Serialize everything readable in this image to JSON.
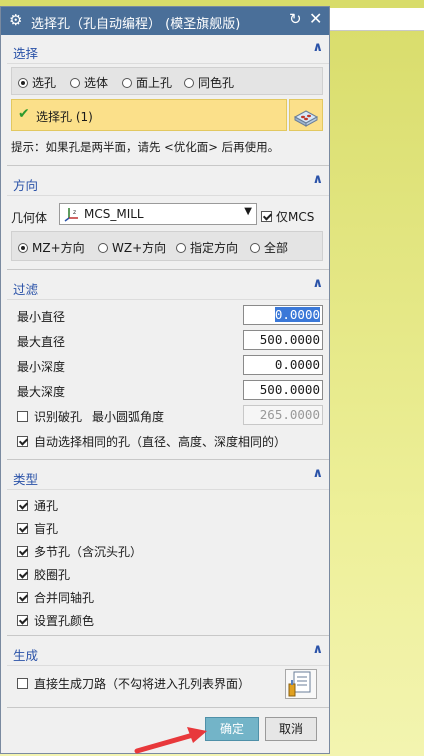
{
  "dialog": {
    "title": "选择孔（孔自动编程）   (模圣旗舰版)"
  },
  "select": {
    "header": "选择",
    "radios": [
      "选孔",
      "选体",
      "面上孔",
      "同色孔"
    ],
    "selected_radio": 0,
    "selected_label": "选择孔 (1)",
    "hint": "提示：如果孔是两半面，请先 <优化面> 后再使用。"
  },
  "direction": {
    "header": "方向",
    "geometry_label": "几何体",
    "geometry_value": "MCS_MILL",
    "only_mcs_label": "仅MCS",
    "only_mcs_checked": true,
    "radios": [
      "MZ+方向",
      "WZ+方向",
      "指定方向",
      "全部"
    ],
    "selected_radio": 0
  },
  "filter": {
    "header": "过滤",
    "fields": [
      {
        "label": "最小直径",
        "value": "0.0000"
      },
      {
        "label": "最大直径",
        "value": "500.0000"
      },
      {
        "label": "最小深度",
        "value": "0.0000"
      },
      {
        "label": "最大深度",
        "value": "500.0000"
      }
    ],
    "break_hole_label": "识别破孔",
    "min_arc_label": "最小圆弧角度",
    "min_arc_value": "265.0000",
    "auto_select_label": "自动选择相同的孔（直径、高度、深度相同的）"
  },
  "type": {
    "header": "类型",
    "items": [
      "通孔",
      "盲孔",
      "多节孔（含沉头孔）",
      "胶圈孔",
      "合并同轴孔",
      "设置孔颜色"
    ]
  },
  "generate": {
    "header": "生成",
    "direct_toolpath_label": "直接生成刀路（不勾将进入孔列表界面）"
  },
  "buttons": {
    "ok": "确定",
    "cancel": "取消"
  },
  "colors": {
    "titlebar": "#4a6f99",
    "section_header": "#2a52a8",
    "selection_highlight": "#fbe08a",
    "ok_button": "#73b4c8",
    "arrow": "#e8383b"
  }
}
